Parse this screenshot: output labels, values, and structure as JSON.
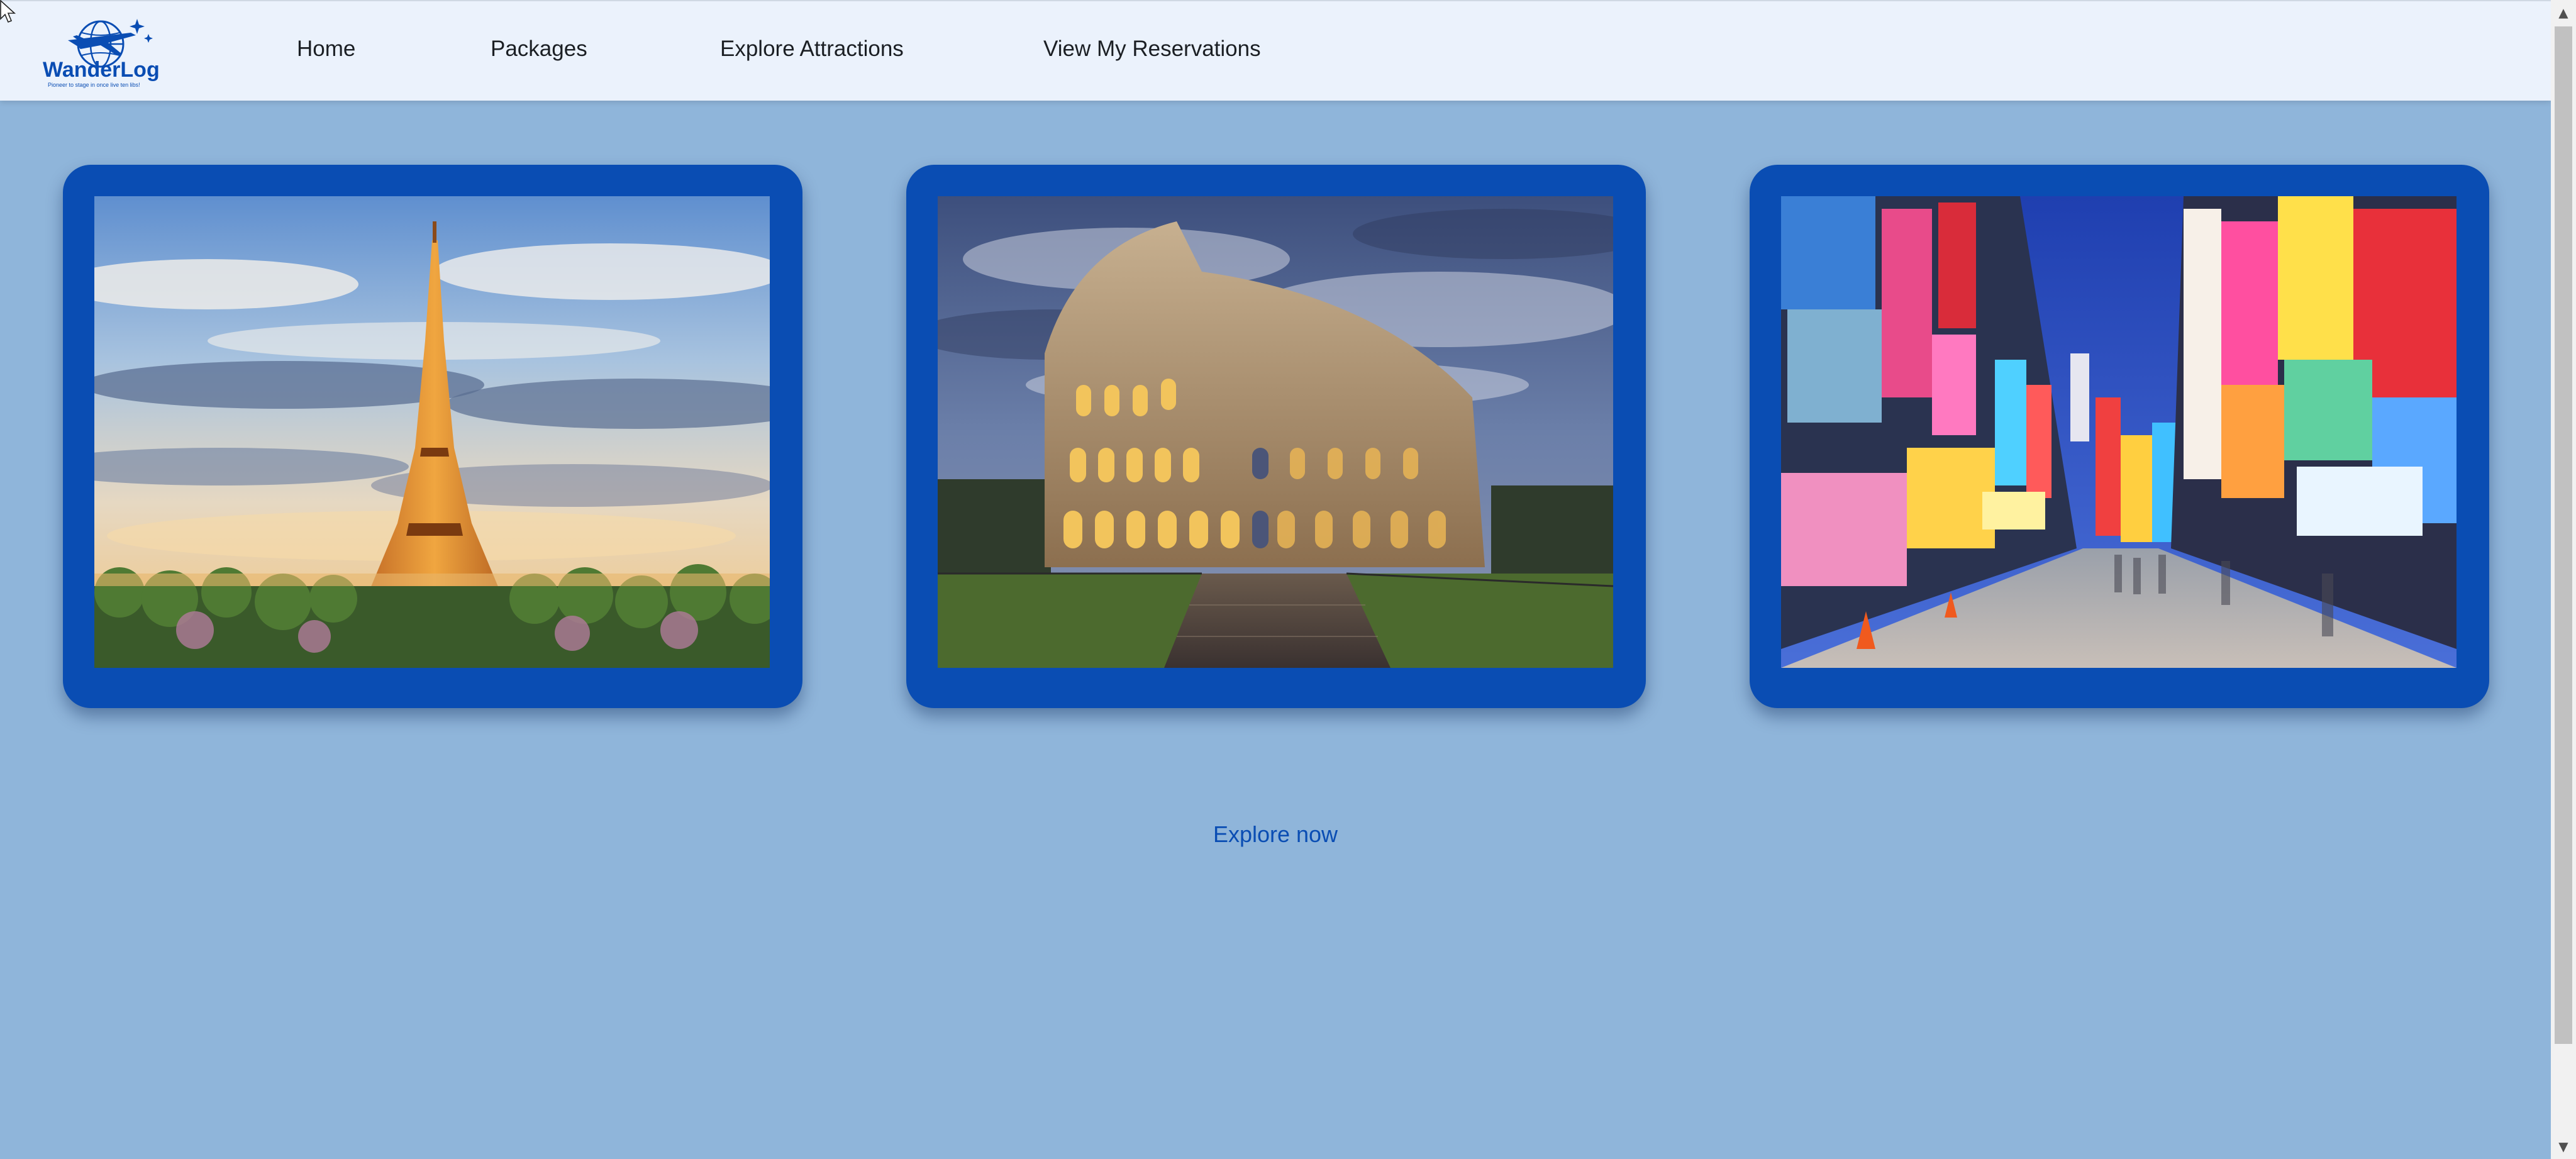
{
  "brand": {
    "name": "WanderLog",
    "tagline": "Pioneer to stage in once live ten libs!",
    "logo_icon": "globe-airplane-logo",
    "primary_color": "#0a4db3",
    "background_color": "#8fb5da",
    "header_color": "#ebf2fc"
  },
  "nav": {
    "items": [
      {
        "label": "Home"
      },
      {
        "label": "Packages"
      },
      {
        "label": "Explore Attractions"
      },
      {
        "label": "View My Reservations"
      }
    ]
  },
  "destinations": [
    {
      "photo": "eiffel-tower-photo"
    },
    {
      "photo": "colosseum-photo"
    },
    {
      "photo": "neon-city-street-photo"
    }
  ],
  "cta": {
    "label": "Explore now"
  },
  "scrollbar": {
    "up_icon": "scroll-up-arrow",
    "down_icon": "scroll-down-arrow"
  }
}
